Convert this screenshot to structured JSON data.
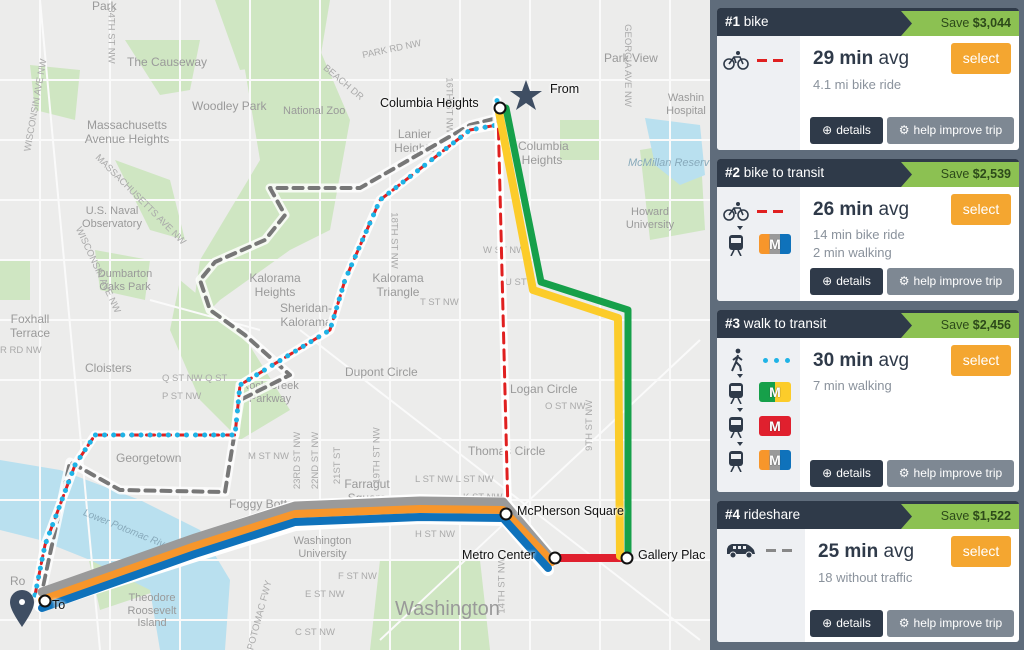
{
  "map": {
    "labels": {
      "park": "Park",
      "causeway": "The Causeway",
      "woodley": "Woodley Park",
      "zoo": "National Zoo",
      "mass_heights": "Massachusetts Avenue Heights",
      "naval": "U.S. Naval Observatory",
      "dumbarton": "Dumbarton Oaks Park",
      "foxhall": "Foxhall Terrace",
      "cloisters": "Cloisters",
      "kalorama_heights": "Kalorama Heights",
      "sheridan": "Sheridan-Kalorama",
      "kalorama_triangle": "Kalorama Triangle",
      "lanier": "Lanier Heights",
      "columbia_area": "Columbia Heights",
      "park_view": "Park View",
      "washington_hospital": "Washin Hospital",
      "mcmillan": "McMillan Reserv",
      "howard": "Howard University",
      "dupont": "Dupont Circle",
      "logan": "Logan Circle",
      "thomas": "Thomas Circle",
      "georgetown": "Georgetown",
      "foggy": "Foggy Bottom",
      "farragut": "Farragut Square",
      "gwu": "Washington University",
      "roosevelt": "Theodore Roosevelt Island",
      "potomac": "Lower Potomac River",
      "washington": "Washington",
      "rock_creek": "Rock Creek Parkway",
      "rosslyn": "Ro"
    },
    "streets": {
      "wisconsin1": "WISCONSIN AVE NW",
      "wisconsin2": "WISCONSIN AVE NW",
      "st34": "34TH ST NW",
      "mass_ave": "MASSACHUSETTS AVE NW",
      "beach": "BEACH DR",
      "park_rd": "PARK RD NW",
      "georgia": "GEORGIA AVE NW",
      "st16": "16TH ST NW",
      "st18": "18TH ST NW",
      "w_st": "W ST NW",
      "u_st": "U ST",
      "t_st": "T ST NW",
      "q_st": "Q ST NW Q ST",
      "p_st": "P ST NW",
      "m_st": "M ST NW",
      "l_st": "L ST NW L ST NW",
      "k_st": "K ST NW",
      "h_st": "H ST NW",
      "f_st": "F ST NW",
      "e_st": "E ST NW",
      "c_st": "C ST NW",
      "o_st": "O ST NW",
      "st9": "9TH ST NW",
      "st14": "14TH ST NW",
      "st23": "23RD ST NW",
      "st22": "22ND ST NW",
      "st21": "21ST ST",
      "st19": "19TH ST NW",
      "potomac_fwy": "POTOMAC FWY",
      "rd_nw": "R RD NW"
    },
    "stations": {
      "columbia": "Columbia Heights",
      "mcpherson": "McPherson Square",
      "metro_center": "Metro Center",
      "gallery": "Gallery Plac",
      "from": "From",
      "to": "To"
    },
    "colors": {
      "green": "#16a04a",
      "yellow": "#fccc2a",
      "red": "#e0202e",
      "orange": "#f7962b",
      "blue": "#0f72bb",
      "silver": "#9a9a9a",
      "walk": "#1fb3e6",
      "bike": "#e02020"
    }
  },
  "trips": [
    {
      "rank": "#1",
      "mode": "bike",
      "save_label": "Save",
      "save": "$3,044",
      "duration": "29 min",
      "avg": "avg",
      "lines": [
        "4.1 mi bike ride"
      ],
      "select": "select",
      "details": "details",
      "help": "help improve trip"
    },
    {
      "rank": "#2",
      "mode": "bike to transit",
      "save_label": "Save",
      "save": "$2,539",
      "duration": "26 min",
      "avg": "avg",
      "lines": [
        "14 min bike ride",
        "2 min walking"
      ],
      "select": "select",
      "details": "details",
      "help": "help improve trip",
      "metro": "M"
    },
    {
      "rank": "#3",
      "mode": "walk to transit",
      "save_label": "Save",
      "save": "$2,456",
      "duration": "30 min",
      "avg": "avg",
      "lines": [
        "7 min walking"
      ],
      "select": "select",
      "details": "details",
      "help": "help improve trip",
      "metro": "M"
    },
    {
      "rank": "#4",
      "mode": "rideshare",
      "save_label": "Save",
      "save": "$1,522",
      "duration": "25 min",
      "avg": "avg",
      "lines": [
        "18 without traffic"
      ],
      "select": "select",
      "details": "details",
      "help": "help improve trip"
    }
  ]
}
